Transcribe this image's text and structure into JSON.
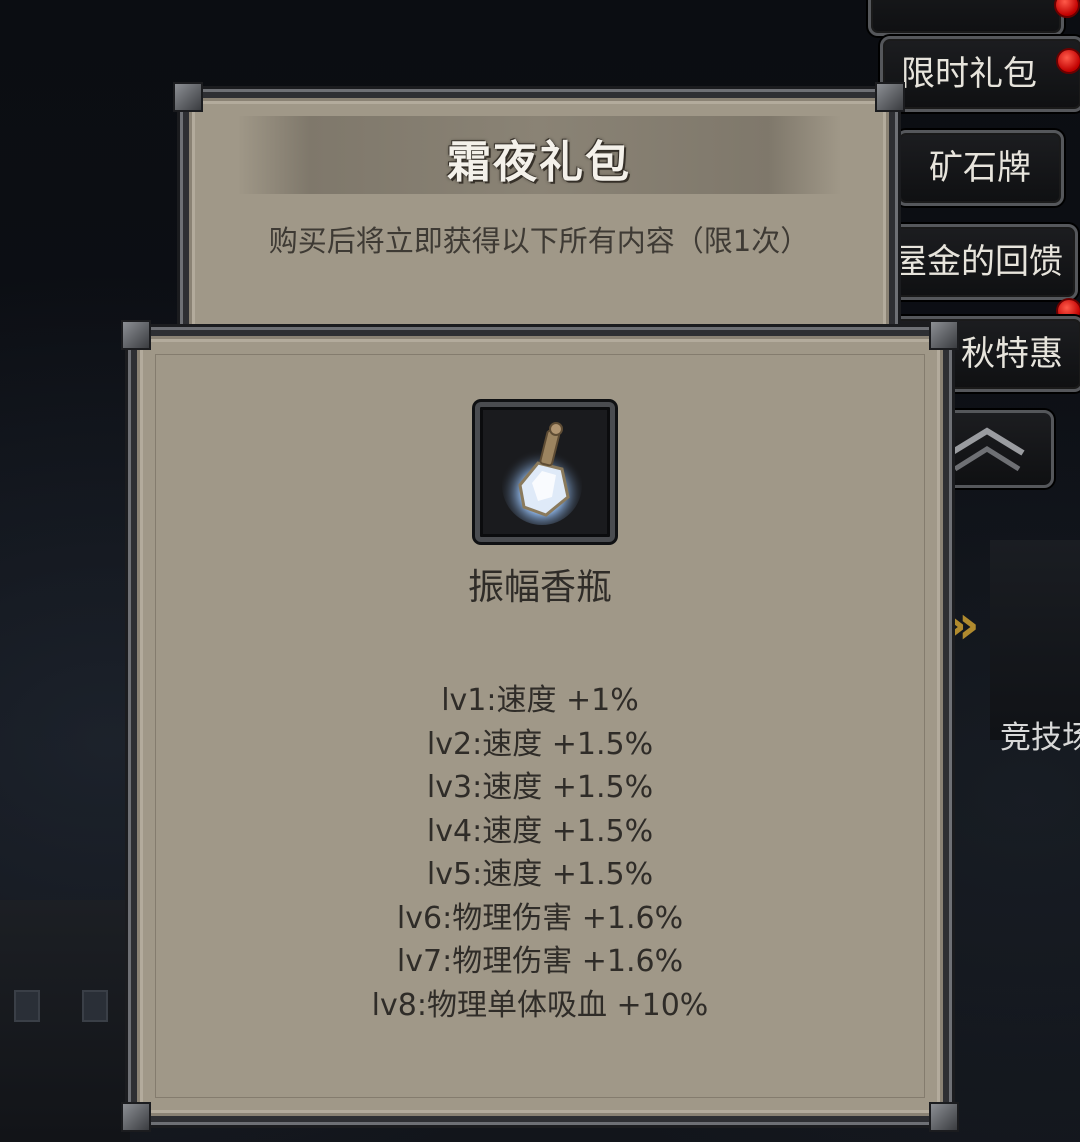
{
  "pack": {
    "title": "霜夜礼包",
    "description": "购买后将立即获得以下所有内容（限1次）"
  },
  "side_menu": [
    {
      "label": "限时礼包",
      "badge": true
    },
    {
      "label": "矿石牌",
      "badge": false
    },
    {
      "label": "屋金的回馈",
      "badge": false
    },
    {
      "label": "秋特惠",
      "badge": true
    }
  ],
  "side_menu_collapse_icon": "double-chevron-up-icon",
  "background": {
    "arena_label": "竞技场",
    "arena_arrow": "»"
  },
  "item": {
    "icon": "crystal-perfume-bottle-icon",
    "name": "振幅香瓶",
    "levels": [
      "lv1:速度 +1%",
      "lv2:速度 +1.5%",
      "lv3:速度 +1.5%",
      "lv4:速度 +1.5%",
      "lv5:速度 +1.5%",
      "lv6:物理伤害 +1.6%",
      "lv7:物理伤害 +1.6%",
      "lv8:物理单体吸血 +10%"
    ]
  },
  "colors": {
    "panel": "#a09888",
    "text_dark": "#2f2c28",
    "badge_red": "#c00000",
    "accent_gold": "#b08a2e"
  }
}
